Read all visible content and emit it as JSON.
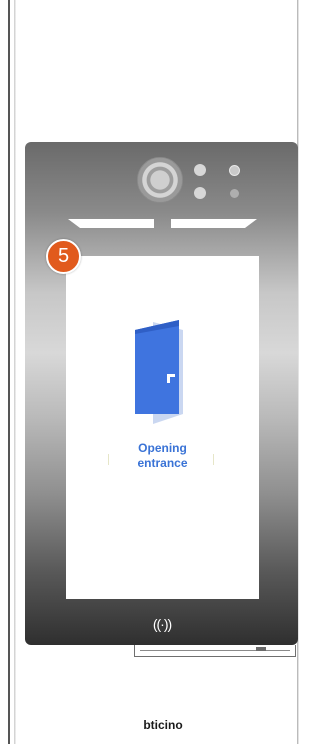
{
  "badge": {
    "number": "5",
    "color": "#e15a1d"
  },
  "door_action": {
    "icon": "door-icon",
    "label_line1": "Opening",
    "label_line2": "entrance",
    "color": "#3a73d6"
  },
  "nfc": {
    "symbol": "((·))",
    "icon": "nfc-icon"
  },
  "brand": {
    "name": "bticino"
  }
}
